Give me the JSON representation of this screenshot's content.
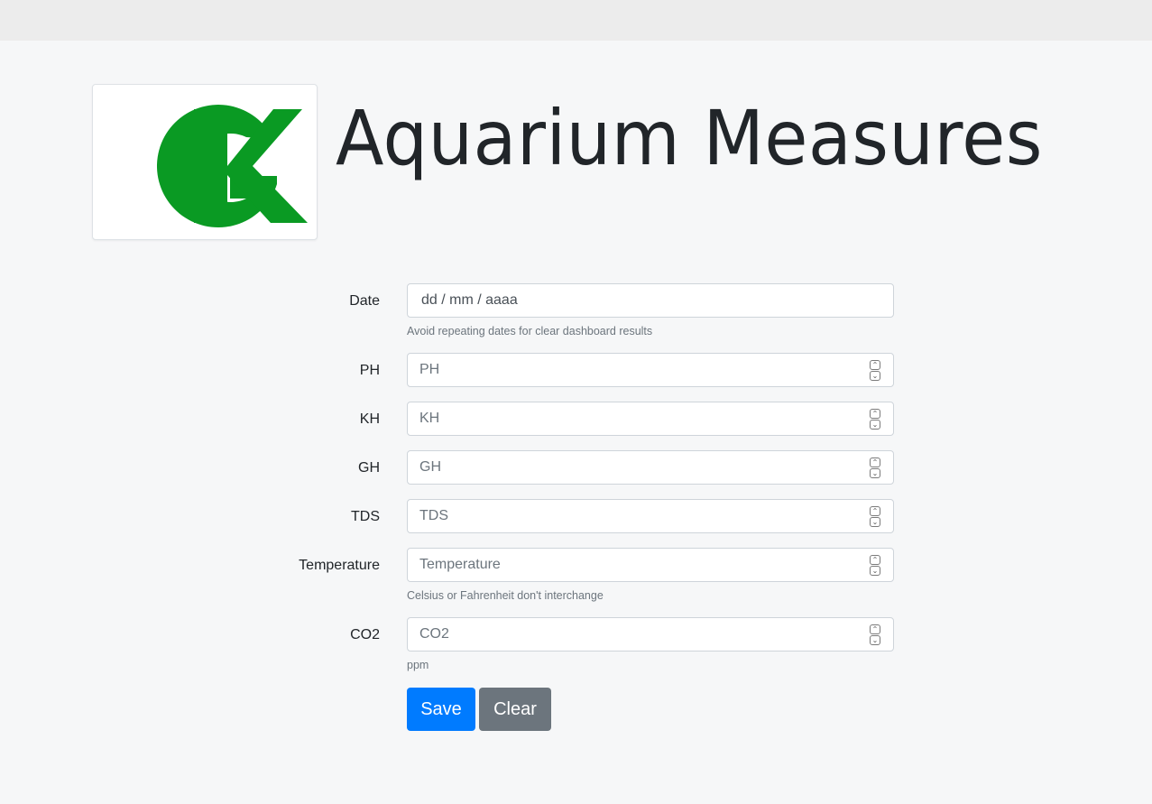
{
  "header": {
    "logo_text": "GK",
    "title": "Aquarium Measures"
  },
  "colors": {
    "logo_green": "#0a9a23",
    "primary": "#007bff",
    "secondary": "#6c757d"
  },
  "form": {
    "date": {
      "label": "Date",
      "value": "dd / mm / aaaa",
      "help": "Avoid repeating dates for clear dashboard results"
    },
    "ph": {
      "label": "PH",
      "placeholder": "PH"
    },
    "kh": {
      "label": "KH",
      "placeholder": "KH"
    },
    "gh": {
      "label": "GH",
      "placeholder": "GH"
    },
    "tds": {
      "label": "TDS",
      "placeholder": "TDS"
    },
    "temperature": {
      "label": "Temperature",
      "placeholder": "Temperature",
      "help": "Celsius or Fahrenheit don't interchange"
    },
    "co2": {
      "label": "CO2",
      "placeholder": "CO2",
      "help": "ppm"
    },
    "save_label": "Save",
    "clear_label": "Clear"
  },
  "icons": {
    "spin_up": "chevron-up-icon",
    "spin_down": "chevron-down-icon"
  }
}
